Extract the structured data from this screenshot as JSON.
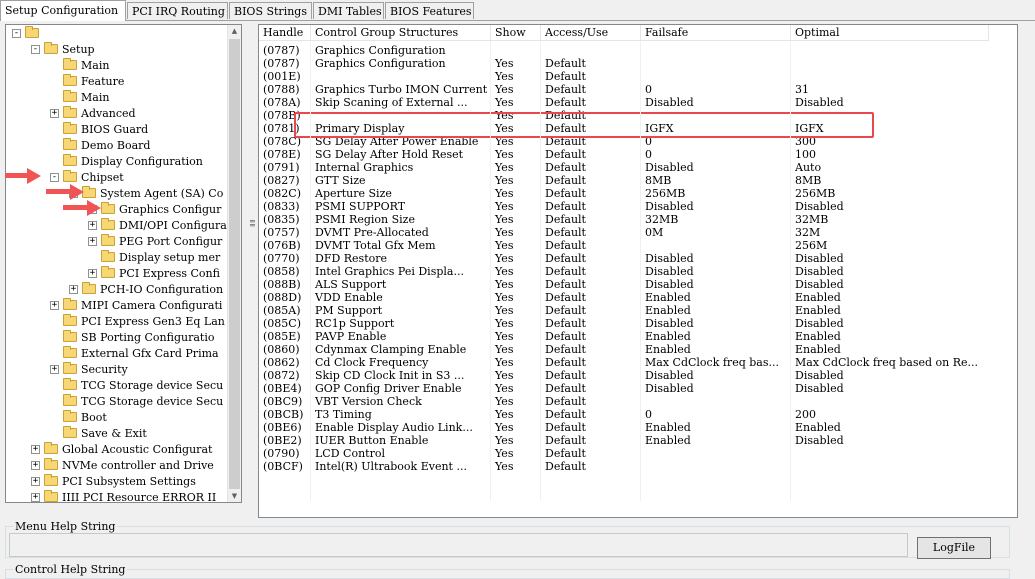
{
  "tabs": [
    {
      "label": "Setup Configuration",
      "active": true
    },
    {
      "label": "PCI IRQ Routing",
      "active": false
    },
    {
      "label": "BIOS Strings",
      "active": false
    },
    {
      "label": "DMI Tables",
      "active": false
    },
    {
      "label": "BIOS Features",
      "active": false
    }
  ],
  "tree": [
    {
      "label": "",
      "depth": 0,
      "expander": "-"
    },
    {
      "label": "Setup",
      "depth": 1,
      "expander": "-"
    },
    {
      "label": "Main",
      "depth": 2,
      "expander": ""
    },
    {
      "label": "Feature",
      "depth": 2,
      "expander": ""
    },
    {
      "label": "Main",
      "depth": 2,
      "expander": ""
    },
    {
      "label": "Advanced",
      "depth": 2,
      "expander": "+"
    },
    {
      "label": "BIOS Guard",
      "depth": 2,
      "expander": ""
    },
    {
      "label": "Demo Board",
      "depth": 2,
      "expander": ""
    },
    {
      "label": "Display Configuration",
      "depth": 2,
      "expander": ""
    },
    {
      "label": "Chipset",
      "depth": 2,
      "expander": "-"
    },
    {
      "label": "System Agent (SA) Co",
      "depth": 3,
      "expander": "-"
    },
    {
      "label": "Graphics Configur",
      "depth": 4,
      "expander": "+"
    },
    {
      "label": "DMI/OPI Configura",
      "depth": 4,
      "expander": "+"
    },
    {
      "label": "PEG Port Configur",
      "depth": 4,
      "expander": "+"
    },
    {
      "label": "Display setup mer",
      "depth": 4,
      "expander": ""
    },
    {
      "label": "PCI Express Confi",
      "depth": 4,
      "expander": "+"
    },
    {
      "label": "PCH-IO Configuration",
      "depth": 3,
      "expander": "+"
    },
    {
      "label": "MIPI Camera Configurati",
      "depth": 2,
      "expander": "+"
    },
    {
      "label": "PCI Express Gen3 Eq Lan",
      "depth": 2,
      "expander": ""
    },
    {
      "label": "SB Porting Configuratio",
      "depth": 2,
      "expander": ""
    },
    {
      "label": "External Gfx Card Prima",
      "depth": 2,
      "expander": ""
    },
    {
      "label": "Security",
      "depth": 2,
      "expander": "+"
    },
    {
      "label": "TCG Storage device Secu",
      "depth": 2,
      "expander": ""
    },
    {
      "label": "TCG Storage device Secu",
      "depth": 2,
      "expander": ""
    },
    {
      "label": "Boot",
      "depth": 2,
      "expander": ""
    },
    {
      "label": "Save & Exit",
      "depth": 2,
      "expander": ""
    },
    {
      "label": "Global Acoustic Configurat",
      "depth": 1,
      "expander": "+"
    },
    {
      "label": "NVMe controller and Drive",
      "depth": 1,
      "expander": "+"
    },
    {
      "label": "PCI Subsystem Settings",
      "depth": 1,
      "expander": "+"
    },
    {
      "label": "IIII PCI Resource ERROR II",
      "depth": 1,
      "expander": "+"
    }
  ],
  "table": {
    "columns": [
      "Handle",
      "Control Group Structures",
      "Show",
      "Access/Use",
      "Failsafe",
      "Optimal"
    ],
    "rows": [
      [
        "(0787)",
        "Graphics Configuration",
        "",
        "",
        "",
        ""
      ],
      [
        "(0787)",
        "Graphics Configuration",
        "Yes",
        "Default",
        "",
        ""
      ],
      [
        "(001E)",
        "",
        "Yes",
        "Default",
        "",
        ""
      ],
      [
        "(0788)",
        "Graphics Turbo IMON Current",
        "Yes",
        "Default",
        "0",
        "31"
      ],
      [
        "(078A)",
        "Skip Scaning of External ...",
        "Yes",
        "Default",
        "Disabled",
        "Disabled"
      ],
      [
        "(078B)",
        "",
        "Yes",
        "Default",
        "",
        ""
      ],
      [
        "(0781)",
        "Primary Display",
        "Yes",
        "Default",
        "IGFX",
        "IGFX"
      ],
      [
        "(078C)",
        "SG Delay After Power Enable",
        "Yes",
        "Default",
        "0",
        "300"
      ],
      [
        "(078E)",
        "SG Delay After Hold Reset",
        "Yes",
        "Default",
        "0",
        "100"
      ],
      [
        "(0791)",
        "Internal Graphics",
        "Yes",
        "Default",
        "Disabled",
        "Auto"
      ],
      [
        "(0827)",
        "GTT Size",
        "Yes",
        "Default",
        "8MB",
        "8MB"
      ],
      [
        "(082C)",
        "Aperture Size",
        "Yes",
        "Default",
        "256MB",
        "256MB"
      ],
      [
        "(0833)",
        "PSMI SUPPORT",
        "Yes",
        "Default",
        "Disabled",
        "Disabled"
      ],
      [
        "(0835)",
        "PSMI Region Size",
        "Yes",
        "Default",
        "32MB",
        "32MB"
      ],
      [
        "(0757)",
        "DVMT Pre-Allocated",
        "Yes",
        "Default",
        "0M",
        "32M"
      ],
      [
        "(076B)",
        "DVMT Total Gfx Mem",
        "Yes",
        "Default",
        "",
        "256M"
      ],
      [
        "(0770)",
        "DFD Restore",
        "Yes",
        "Default",
        "Disabled",
        "Disabled"
      ],
      [
        "(0858)",
        "Intel Graphics Pei Displa...",
        "Yes",
        "Default",
        "Disabled",
        "Disabled"
      ],
      [
        "(088B)",
        "ALS Support",
        "Yes",
        "Default",
        "Disabled",
        "Disabled"
      ],
      [
        "(088D)",
        "VDD Enable",
        "Yes",
        "Default",
        "Enabled",
        "Enabled"
      ],
      [
        "(085A)",
        "PM Support",
        "Yes",
        "Default",
        "Enabled",
        "Enabled"
      ],
      [
        "(085C)",
        "RC1p Support",
        "Yes",
        "Default",
        "Disabled",
        "Disabled"
      ],
      [
        "(085E)",
        "PAVP Enable",
        "Yes",
        "Default",
        "Enabled",
        "Enabled"
      ],
      [
        "(0860)",
        "Cdynmax Clamping Enable",
        "Yes",
        "Default",
        "Enabled",
        "Enabled"
      ],
      [
        "(0862)",
        "Cd Clock Frequency",
        "Yes",
        "Default",
        "Max CdClock freq bas...",
        "Max CdClock freq based on Re..."
      ],
      [
        "(0872)",
        "Skip CD Clock Init in S3 ...",
        "Yes",
        "Default",
        "Disabled",
        "Disabled"
      ],
      [
        "(0BE4)",
        "GOP Config Driver Enable",
        "Yes",
        "Default",
        "Disabled",
        "Disabled"
      ],
      [
        "(0BC9)",
        "VBT Version Check",
        "Yes",
        "Default",
        "",
        ""
      ],
      [
        "(0BCB)",
        "T3 Timing",
        "Yes",
        "Default",
        "0",
        "200"
      ],
      [
        "(0BE6)",
        "Enable Display Audio Link...",
        "Yes",
        "Default",
        "Enabled",
        "Enabled"
      ],
      [
        "(0BE2)",
        "IUER Button Enable",
        "Yes",
        "Default",
        "Enabled",
        "Disabled"
      ],
      [
        "(0790)",
        "LCD Control",
        "Yes",
        "Default",
        "",
        ""
      ],
      [
        "(0BCF)",
        "Intel(R) Ultrabook Event ...",
        "Yes",
        "Default",
        "",
        ""
      ]
    ]
  },
  "help": {
    "menu_label": "Menu Help String",
    "control_label": "Control Help String",
    "logfile_button": "LogFile"
  },
  "colors": {
    "highlight": "#e8484d",
    "arrow": "#f05454"
  }
}
